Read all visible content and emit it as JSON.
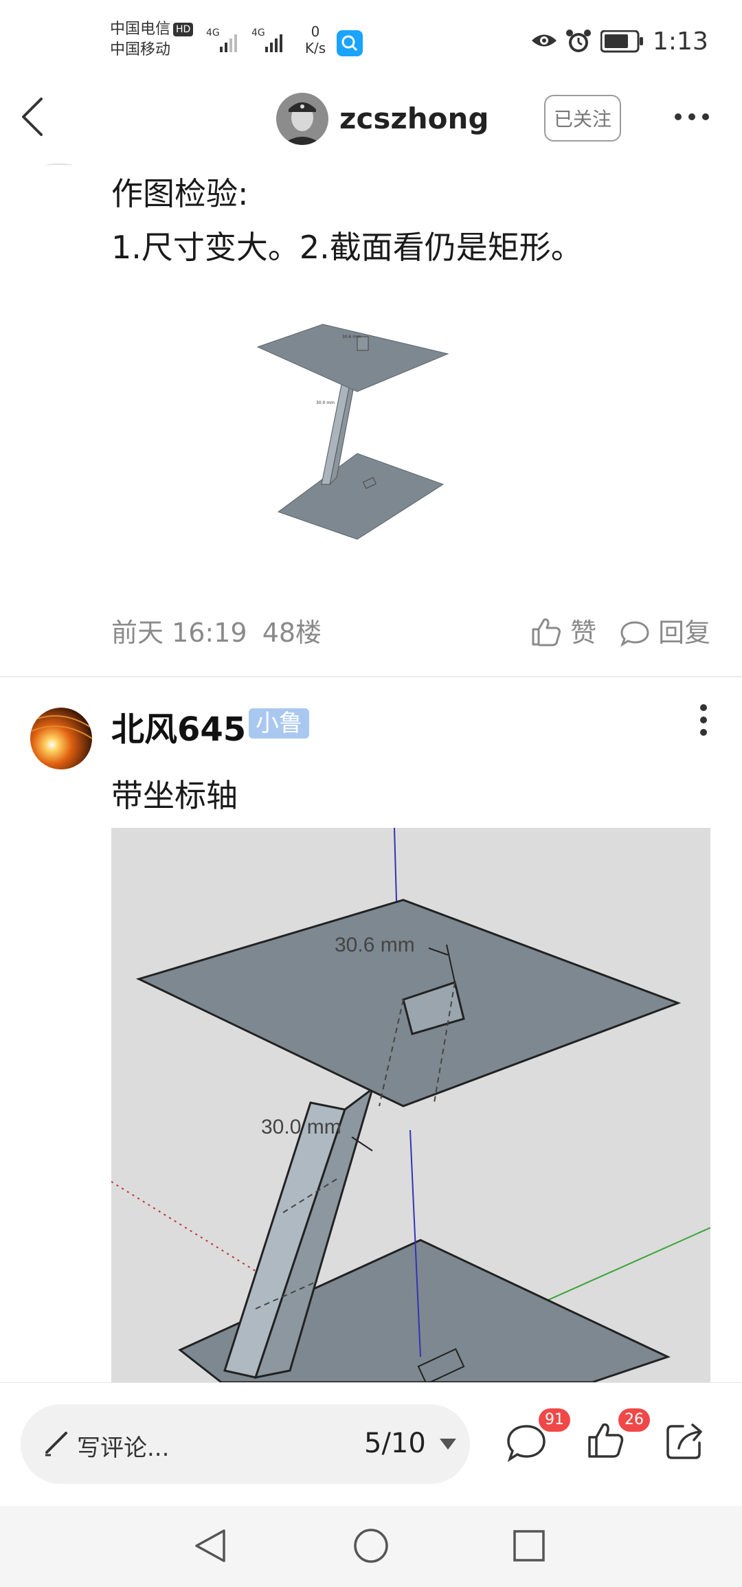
{
  "status_bar": {
    "carrier1": "中国电信",
    "hd_badge": "HD",
    "carrier2": "中国移动",
    "signal1": "4G",
    "signal2": "4G",
    "net_speed_value": "0",
    "net_speed_unit": "K/s",
    "time": "1:13"
  },
  "header": {
    "username": "zcszhong",
    "follow_label": "已关注"
  },
  "post1": {
    "line1": "作图检验:",
    "line2": "1.尺寸变大。2.截面看仍是矩形。",
    "image_labels": {
      "top": "30.6 mm",
      "side": "30.0 mm"
    },
    "time": "前天 16:19",
    "floor": "48楼",
    "like_label": "赞",
    "reply_label": "回复"
  },
  "post2": {
    "username": "北风645",
    "badge": "小鲁",
    "text": "带坐标轴",
    "image_labels": {
      "top": "30.6 mm",
      "side": "30.0 mm"
    }
  },
  "bottom_bar": {
    "comment_placeholder": "写评论...",
    "page_indicator": "5/10",
    "comment_count": "91",
    "like_count": "26"
  },
  "colors": {
    "accent_red": "#f04848",
    "badge_blue": "#a9c8f0",
    "search_blue": "#1aa3ff"
  }
}
